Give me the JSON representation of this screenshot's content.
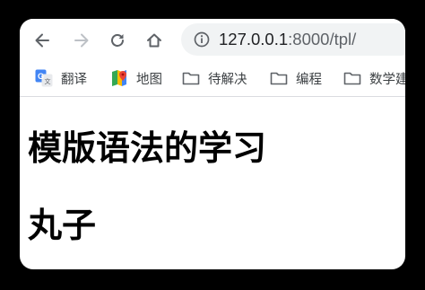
{
  "browser": {
    "url_host": "127.0.0.1",
    "url_rest": ":8000/tpl/",
    "icons": {
      "back": "back-arrow-icon",
      "forward": "forward-arrow-icon",
      "reload": "reload-icon",
      "home": "home-icon",
      "info": "info-icon"
    }
  },
  "bookmarks": [
    {
      "label": "翻译",
      "icon": "google-translate-icon"
    },
    {
      "label": "地图",
      "icon": "google-maps-icon"
    },
    {
      "label": "待解决",
      "icon": "folder-icon"
    },
    {
      "label": "编程",
      "icon": "folder-icon"
    },
    {
      "label": "数学建",
      "icon": "folder-icon"
    }
  ],
  "page": {
    "heading": "模版语法的学习",
    "subheading": "丸子"
  },
  "colors": {
    "frame": "#000000",
    "omnibox": "#f1f3f4",
    "icon": "#5f6368",
    "icon_disabled": "#bdc1c6"
  }
}
